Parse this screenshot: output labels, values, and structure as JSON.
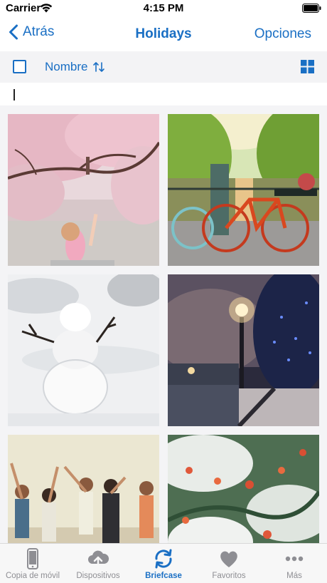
{
  "status_bar": {
    "carrier": "Carrier",
    "time": "4:15 PM"
  },
  "nav": {
    "back_label": "Atrás",
    "title": "Holidays",
    "options_label": "Opciones"
  },
  "toolbar": {
    "sort_label": "Nombre"
  },
  "search": {
    "value": "",
    "placeholder": ""
  },
  "grid": {
    "items": [
      {
        "subject": "cherry blossom with child"
      },
      {
        "subject": "bicycle on canal bridge"
      },
      {
        "subject": "snowman in snow"
      },
      {
        "subject": "lamp post at night by river"
      },
      {
        "subject": "friends dancing on beach"
      },
      {
        "subject": "snow-covered berries"
      }
    ]
  },
  "tabs": [
    {
      "label": "Copia de móvil",
      "icon": "phone-icon",
      "active": false
    },
    {
      "label": "Dispositivos",
      "icon": "cloud-upload-icon",
      "active": false
    },
    {
      "label": "Briefcase",
      "icon": "sync-icon",
      "active": true
    },
    {
      "label": "Favoritos",
      "icon": "heart-icon",
      "active": false
    },
    {
      "label": "Más",
      "icon": "more-icon",
      "active": false
    }
  ],
  "colors": {
    "accent": "#1a6fc4",
    "inactive": "#8e8e93",
    "toolbar_bg": "#f3f3f5"
  }
}
